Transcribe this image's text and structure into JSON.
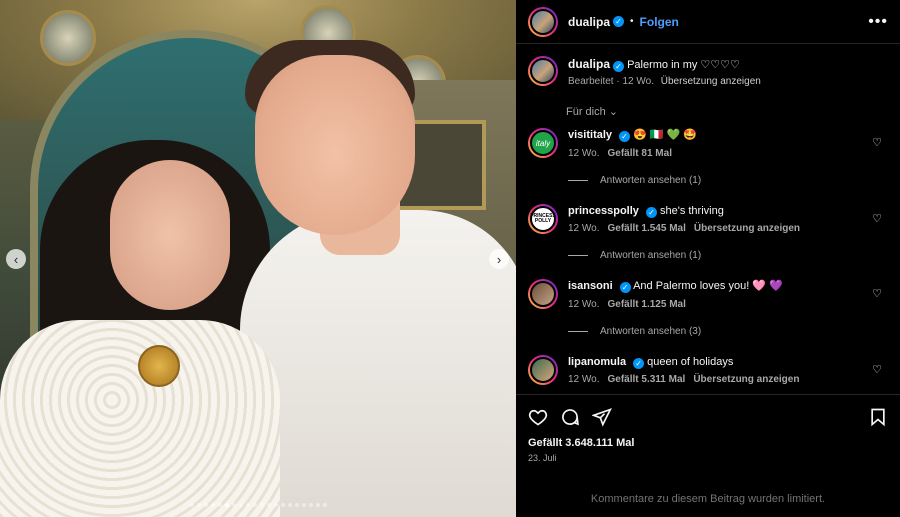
{
  "header": {
    "username": "dualipa",
    "bullet": "•",
    "follow_label": "Folgen",
    "more_icon": "more-horizontal-icon"
  },
  "caption": {
    "username": "dualipa",
    "text": "Palermo in my ♡♡♡♡",
    "meta": "Bearbeitet · 12 Wo.",
    "translate": "Übersetzung anzeigen"
  },
  "for_you": "Für dich ⌄",
  "comments": [
    {
      "username": "visititaly",
      "text": "😍 🇮🇹 💚 🤩",
      "time": "12 Wo.",
      "likes": "Gefällt 81 Mal",
      "translate": "",
      "replies": "Antworten ansehen (1)",
      "avatar_text": "italy"
    },
    {
      "username": "princesspolly",
      "text": "she's thriving",
      "time": "12 Wo.",
      "likes": "Gefällt 1.545 Mal",
      "translate": "Übersetzung anzeigen",
      "replies": "Antworten ansehen (1)",
      "avatar_text": "PRINCESS POLLY"
    },
    {
      "username": "isansoni",
      "text": "And Palermo loves you! 🩷 💜",
      "time": "12 Wo.",
      "likes": "Gefällt 1.125 Mal",
      "translate": "",
      "replies": "Antworten ansehen (3)",
      "avatar_text": ""
    },
    {
      "username": "lipanomula",
      "text": "queen of holidays",
      "time": "12 Wo.",
      "likes": "Gefällt 5.311 Mal",
      "translate": "Übersetzung anzeigen",
      "replies": "",
      "avatar_text": ""
    }
  ],
  "actions": {
    "like_icon": "heart-icon",
    "comment_icon": "comment-icon",
    "share_icon": "share-icon",
    "save_icon": "bookmark-icon",
    "likes": "Gefällt 3.648.111 Mal",
    "date": "23. Juli",
    "limited": "Kommentare zu diesem Beitrag wurden limitiert."
  },
  "carousel": {
    "total": 20,
    "active_index": 5,
    "prev": "‹",
    "next": "›"
  },
  "colors": {
    "accent": "#4f9dff",
    "verified": "#0095f6",
    "background": "#000000"
  }
}
